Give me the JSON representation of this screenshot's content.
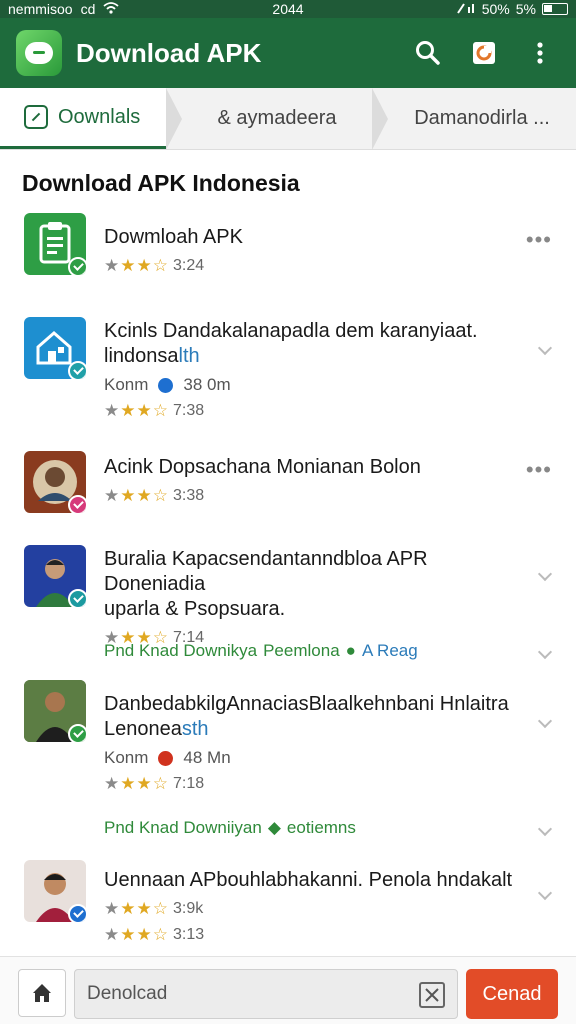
{
  "status_bar": {
    "carrier": "nemmisoo",
    "extra": "cd",
    "time": "2044",
    "battery": "50%",
    "battery2": "5%"
  },
  "app_bar": {
    "title": "Download APK",
    "icons": [
      "app-logo",
      "search-icon",
      "share-icon",
      "more-vert-icon"
    ]
  },
  "tabs": [
    {
      "label": "Oownlals",
      "active": true
    },
    {
      "label": "& aymadeera"
    },
    {
      "label": "Damanodirla ..."
    }
  ],
  "section_title": "Download APK Indonesia",
  "items": [
    {
      "title": "Dowmloah APK",
      "rating_text": "3:24",
      "trailing": "more"
    },
    {
      "title": "Kcinls Dandakalanapadla dem karanyiaat.",
      "title_line2_a": "lindonsa",
      "title_line2_b": "lth",
      "meta_a": "Konm",
      "meta_b": "38 0m",
      "rating_text": "7:38",
      "trailing": "chevron"
    },
    {
      "title": "Acink Dopsachana Monianan Bolon",
      "rating_text": "3:38",
      "trailing": "more"
    },
    {
      "title": "Buralia Kapacsendantanndbloa APR Doneniadia",
      "title_line2": "uparla & Psopsuara.",
      "rating_text": "7:14",
      "trailing": "chevron",
      "tagline_a": "Pnd Knad Downikya",
      "tagline_b": "Peemlona",
      "tagline_c": "A Reag"
    },
    {
      "title": "DanbedabkilgAnnaciasBlaalkehnbani Hnlaitra",
      "title_line2_a": "Lenonea",
      "title_line2_b": "sth",
      "meta_a": "Konm",
      "meta_b": "48 Mn",
      "rating_text": "7:18",
      "trailing": "chevron",
      "tagline_a": "Pnd Knad Downiiyan",
      "tagline_b": "eotiemns"
    },
    {
      "title": "Uennaan APbouhlabhakanni. Penola hndakalt",
      "rating_text": "3:9k",
      "rating_text2": "3:13",
      "trailing": "chevron"
    }
  ],
  "bottom_bar": {
    "search_placeholder": "Denolcad",
    "send_label": "Cenad"
  },
  "colors": {
    "primary": "#1e6b3c",
    "accent": "#e24c28",
    "link": "#2b7bb9",
    "star": "#e0a822"
  }
}
